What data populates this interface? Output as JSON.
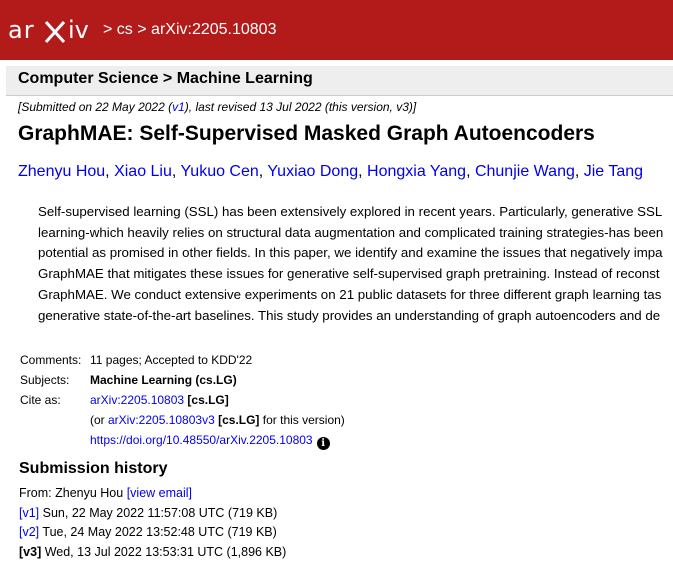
{
  "header": {
    "logo_text": "arXiv",
    "crumbs": [
      ">",
      "cs",
      ">",
      "arXiv:2205.10803"
    ],
    "bg_color": "#b31b1b"
  },
  "subheader": {
    "text": "Computer Science > Machine Learning"
  },
  "submission_note": {
    "prefix": "[Submitted on 22 May 2022 (",
    "v1_link": "v1",
    "suffix": "), last revised 13 Jul 2022 (this version, v3)]"
  },
  "paper": {
    "title": "GraphMAE: Self-Supervised Masked Graph Autoencoders",
    "authors": [
      "Zhenyu Hou",
      "Xiao Liu",
      "Yukuo Cen",
      "Yuxiao Dong",
      "Hongxia Yang",
      "Chunjie Wang",
      "Jie Tang"
    ],
    "author_sep": ", ",
    "abstract_lines": [
      "Self-supervised learning (SSL) has been extensively explored in recent years. Particularly, generative SSL",
      "learning-which heavily relies on structural data augmentation and complicated training strategies-has been",
      "potential as promised in other fields. In this paper, we identify and examine the issues that negatively impa",
      "GraphMAE that mitigates these issues for generative self-supervised graph pretraining. Instead of reconst",
      "GraphMAE. We conduct extensive experiments on 21 public datasets for three different graph learning tas",
      "generative state-of-the-art baselines. This study provides an understanding of graph autoencoders and de"
    ]
  },
  "meta": {
    "comments_key": "Comments:",
    "comments_val": "11 pages; Accepted to KDD'22",
    "subjects_key": "Subjects:",
    "subjects_val": "Machine Learning (cs.LG)",
    "cite_key": "Cite as:",
    "cite_link": "arXiv:2205.10803",
    "cite_tag": "[cs.LG]",
    "cite2_prefix": "(or ",
    "cite2_link": "arXiv:2205.10803v3",
    "cite2_tag": "[cs.LG]",
    "cite2_suffix": " for this version)",
    "doi_link": "https://doi.org/10.48550/arXiv.2205.10803",
    "info_icon": "info-icon"
  },
  "history": {
    "title": "Submission history",
    "from_prefix": "From: Zhenyu Hou ",
    "view_email": "[view email]",
    "versions": [
      {
        "label": "[v1]",
        "text": " Sun, 22 May 2022 11:57:08 UTC (719 KB)",
        "is_link": true
      },
      {
        "label": "[v2]",
        "text": " Tue, 24 May 2022 13:52:48 UTC (719 KB)",
        "is_link": true
      },
      {
        "label": "[v3]",
        "text": " Wed, 13 Jul 2022 13:53:31 UTC (1,896 KB)",
        "is_link": false
      }
    ]
  }
}
